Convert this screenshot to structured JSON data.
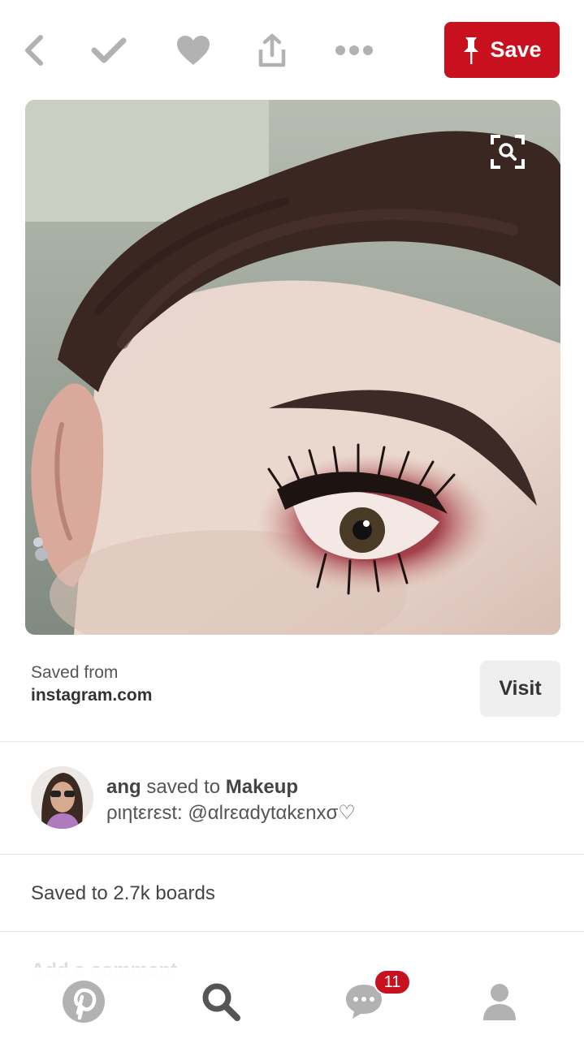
{
  "toolbar": {
    "back_icon": "chevron-left-icon",
    "done_icon": "checkmark-icon",
    "like_icon": "heart-icon",
    "share_icon": "share-icon",
    "more_icon": "more-icon",
    "save_label": "Save",
    "save_icon": "pin-icon"
  },
  "pin": {
    "subject": "makeup-photo",
    "lens_icon": "visual-search-icon"
  },
  "source": {
    "saved_from_label": "Saved from",
    "domain": "instagram.com",
    "visit_label": "Visit"
  },
  "attribution": {
    "user": "ang",
    "action": " saved to ",
    "board": "Makeup",
    "description": "ριηtεrεst: @αlrεαdуtαkεnxσ♡"
  },
  "boards": {
    "text": "Saved to 2.7k boards"
  },
  "comment": {
    "placeholder": "Add a comment"
  },
  "bottom_nav": {
    "items": [
      "pinterest-logo-icon",
      "search-icon",
      "messages-icon",
      "profile-icon"
    ],
    "notifications_count": "11"
  },
  "colors": {
    "brand_red": "#c8101e",
    "icon_gray": "#b2b2b2",
    "active_icon": "#555555"
  }
}
